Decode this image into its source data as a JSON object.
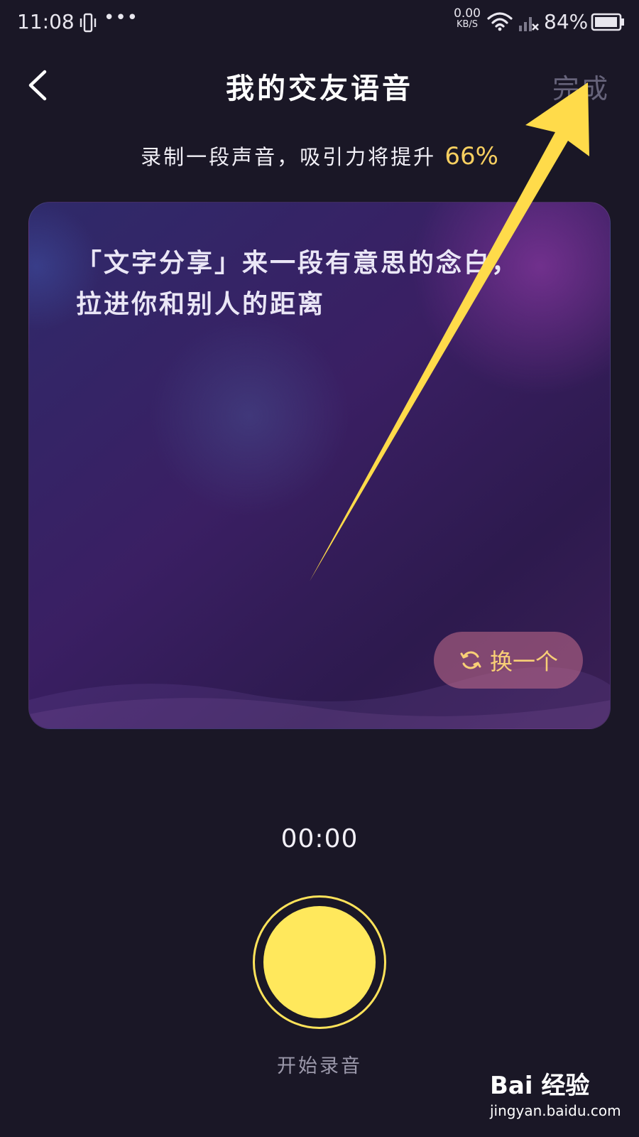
{
  "status_bar": {
    "time": "11:08",
    "net_speed_value": "0.00",
    "net_speed_unit": "KB/S",
    "battery": "84%",
    "icons": [
      "vibrate-icon",
      "more-dots-icon",
      "wifi-icon",
      "signal-icon",
      "battery-icon"
    ]
  },
  "header": {
    "title": "我的交友语音",
    "done_label": "完成",
    "back_icon": "chevron-left-icon"
  },
  "promo": {
    "text": "录制一段声音，吸引力将提升",
    "percent": "66%"
  },
  "card": {
    "prompt_text": "「文字分享」来一段有意思的念白，拉进你和别人的距离",
    "swap_label": "换一个",
    "swap_icon": "refresh-icon"
  },
  "recorder": {
    "timer": "00:00",
    "start_label": "开始录音"
  },
  "watermark": {
    "logo": "Bai 经验",
    "url": "jingyan.baidu.com"
  },
  "colors": {
    "background": "#1a1726",
    "accent_yellow": "#ffe85c",
    "percent_color": "#f7cf60",
    "swap_text": "#f8cf76",
    "done_disabled": "#66637a"
  }
}
